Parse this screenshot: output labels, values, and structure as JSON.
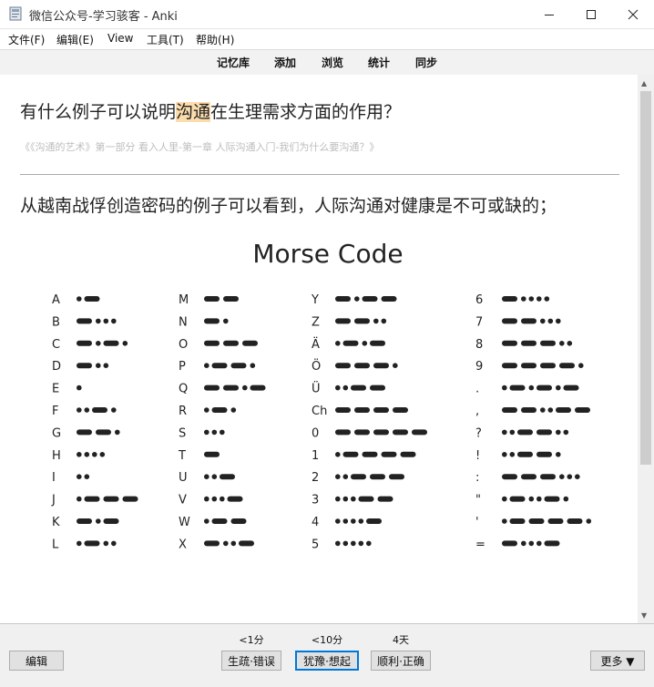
{
  "window": {
    "title": "微信公众号-学习骇客 - Anki"
  },
  "menu": [
    "文件(F)",
    "编辑(E)",
    "View",
    "工具(T)",
    "帮助(H)"
  ],
  "toolbar": [
    "记忆库",
    "添加",
    "浏览",
    "统计",
    "同步"
  ],
  "card": {
    "question_before": "有什么例子可以说明",
    "question_highlight": "沟通",
    "question_after": "在生理需求方面的作用？",
    "source": "《《沟通的艺术》第一部分 看入人里-第一章 人际沟通入门-我们为什么要沟通？》",
    "answer": "从越南战俘创造密码的例子可以看到，人际沟通对健康是不可或缺的；",
    "image": {
      "title": "Morse Code",
      "columns": [
        [
          [
            "A",
            ".-"
          ],
          [
            "B",
            "-..."
          ],
          [
            "C",
            "-.-."
          ],
          [
            "D",
            "-.."
          ],
          [
            "E",
            "."
          ],
          [
            "F",
            "..-."
          ],
          [
            "G",
            "--."
          ],
          [
            "H",
            "...."
          ],
          [
            "I",
            ".."
          ],
          [
            "J",
            ".---"
          ],
          [
            "K",
            "-.-"
          ],
          [
            "L",
            ".-.."
          ]
        ],
        [
          [
            "M",
            "--"
          ],
          [
            "N",
            "-."
          ],
          [
            "O",
            "---"
          ],
          [
            "P",
            ".--."
          ],
          [
            "Q",
            "--.-"
          ],
          [
            "R",
            ".-."
          ],
          [
            "S",
            "..."
          ],
          [
            "T",
            "-"
          ],
          [
            "U",
            "..-"
          ],
          [
            "V",
            "...-"
          ],
          [
            "W",
            ".--"
          ],
          [
            "X",
            "-..-"
          ]
        ],
        [
          [
            "Y",
            "-.--"
          ],
          [
            "Z",
            "--.."
          ],
          [
            "Ä",
            ".-.-"
          ],
          [
            "Ö",
            "---."
          ],
          [
            "Ü",
            "..--"
          ],
          [
            "Ch",
            "----"
          ],
          [
            "0",
            "-----"
          ],
          [
            "1",
            ".----"
          ],
          [
            "2",
            "..---"
          ],
          [
            "3",
            "...--"
          ],
          [
            "4",
            "....-"
          ],
          [
            "5",
            "....."
          ]
        ],
        [
          [
            "6",
            "-...."
          ],
          [
            "7",
            "--..."
          ],
          [
            "8",
            "---.."
          ],
          [
            "9",
            "----."
          ],
          [
            ".",
            ".-.-.-"
          ],
          [
            ",",
            "--..--"
          ],
          [
            "?",
            "..--.."
          ],
          [
            "!",
            "..--."
          ],
          [
            ":",
            "---..."
          ],
          [
            "\"",
            ".-..-."
          ],
          [
            "'",
            ".----."
          ],
          [
            "=",
            "-...-"
          ]
        ]
      ]
    }
  },
  "bottom": {
    "edit": "编辑",
    "answers": [
      {
        "interval": "<1分",
        "label": "生疏·错误"
      },
      {
        "interval": "<10分",
        "label": "犹豫·想起"
      },
      {
        "interval": "4天",
        "label": "顺利·正确"
      }
    ],
    "more": "更多 ▼"
  },
  "colors": {
    "highlight": "#fbdcac",
    "focus": "#0078d7",
    "morse": "#222222"
  }
}
